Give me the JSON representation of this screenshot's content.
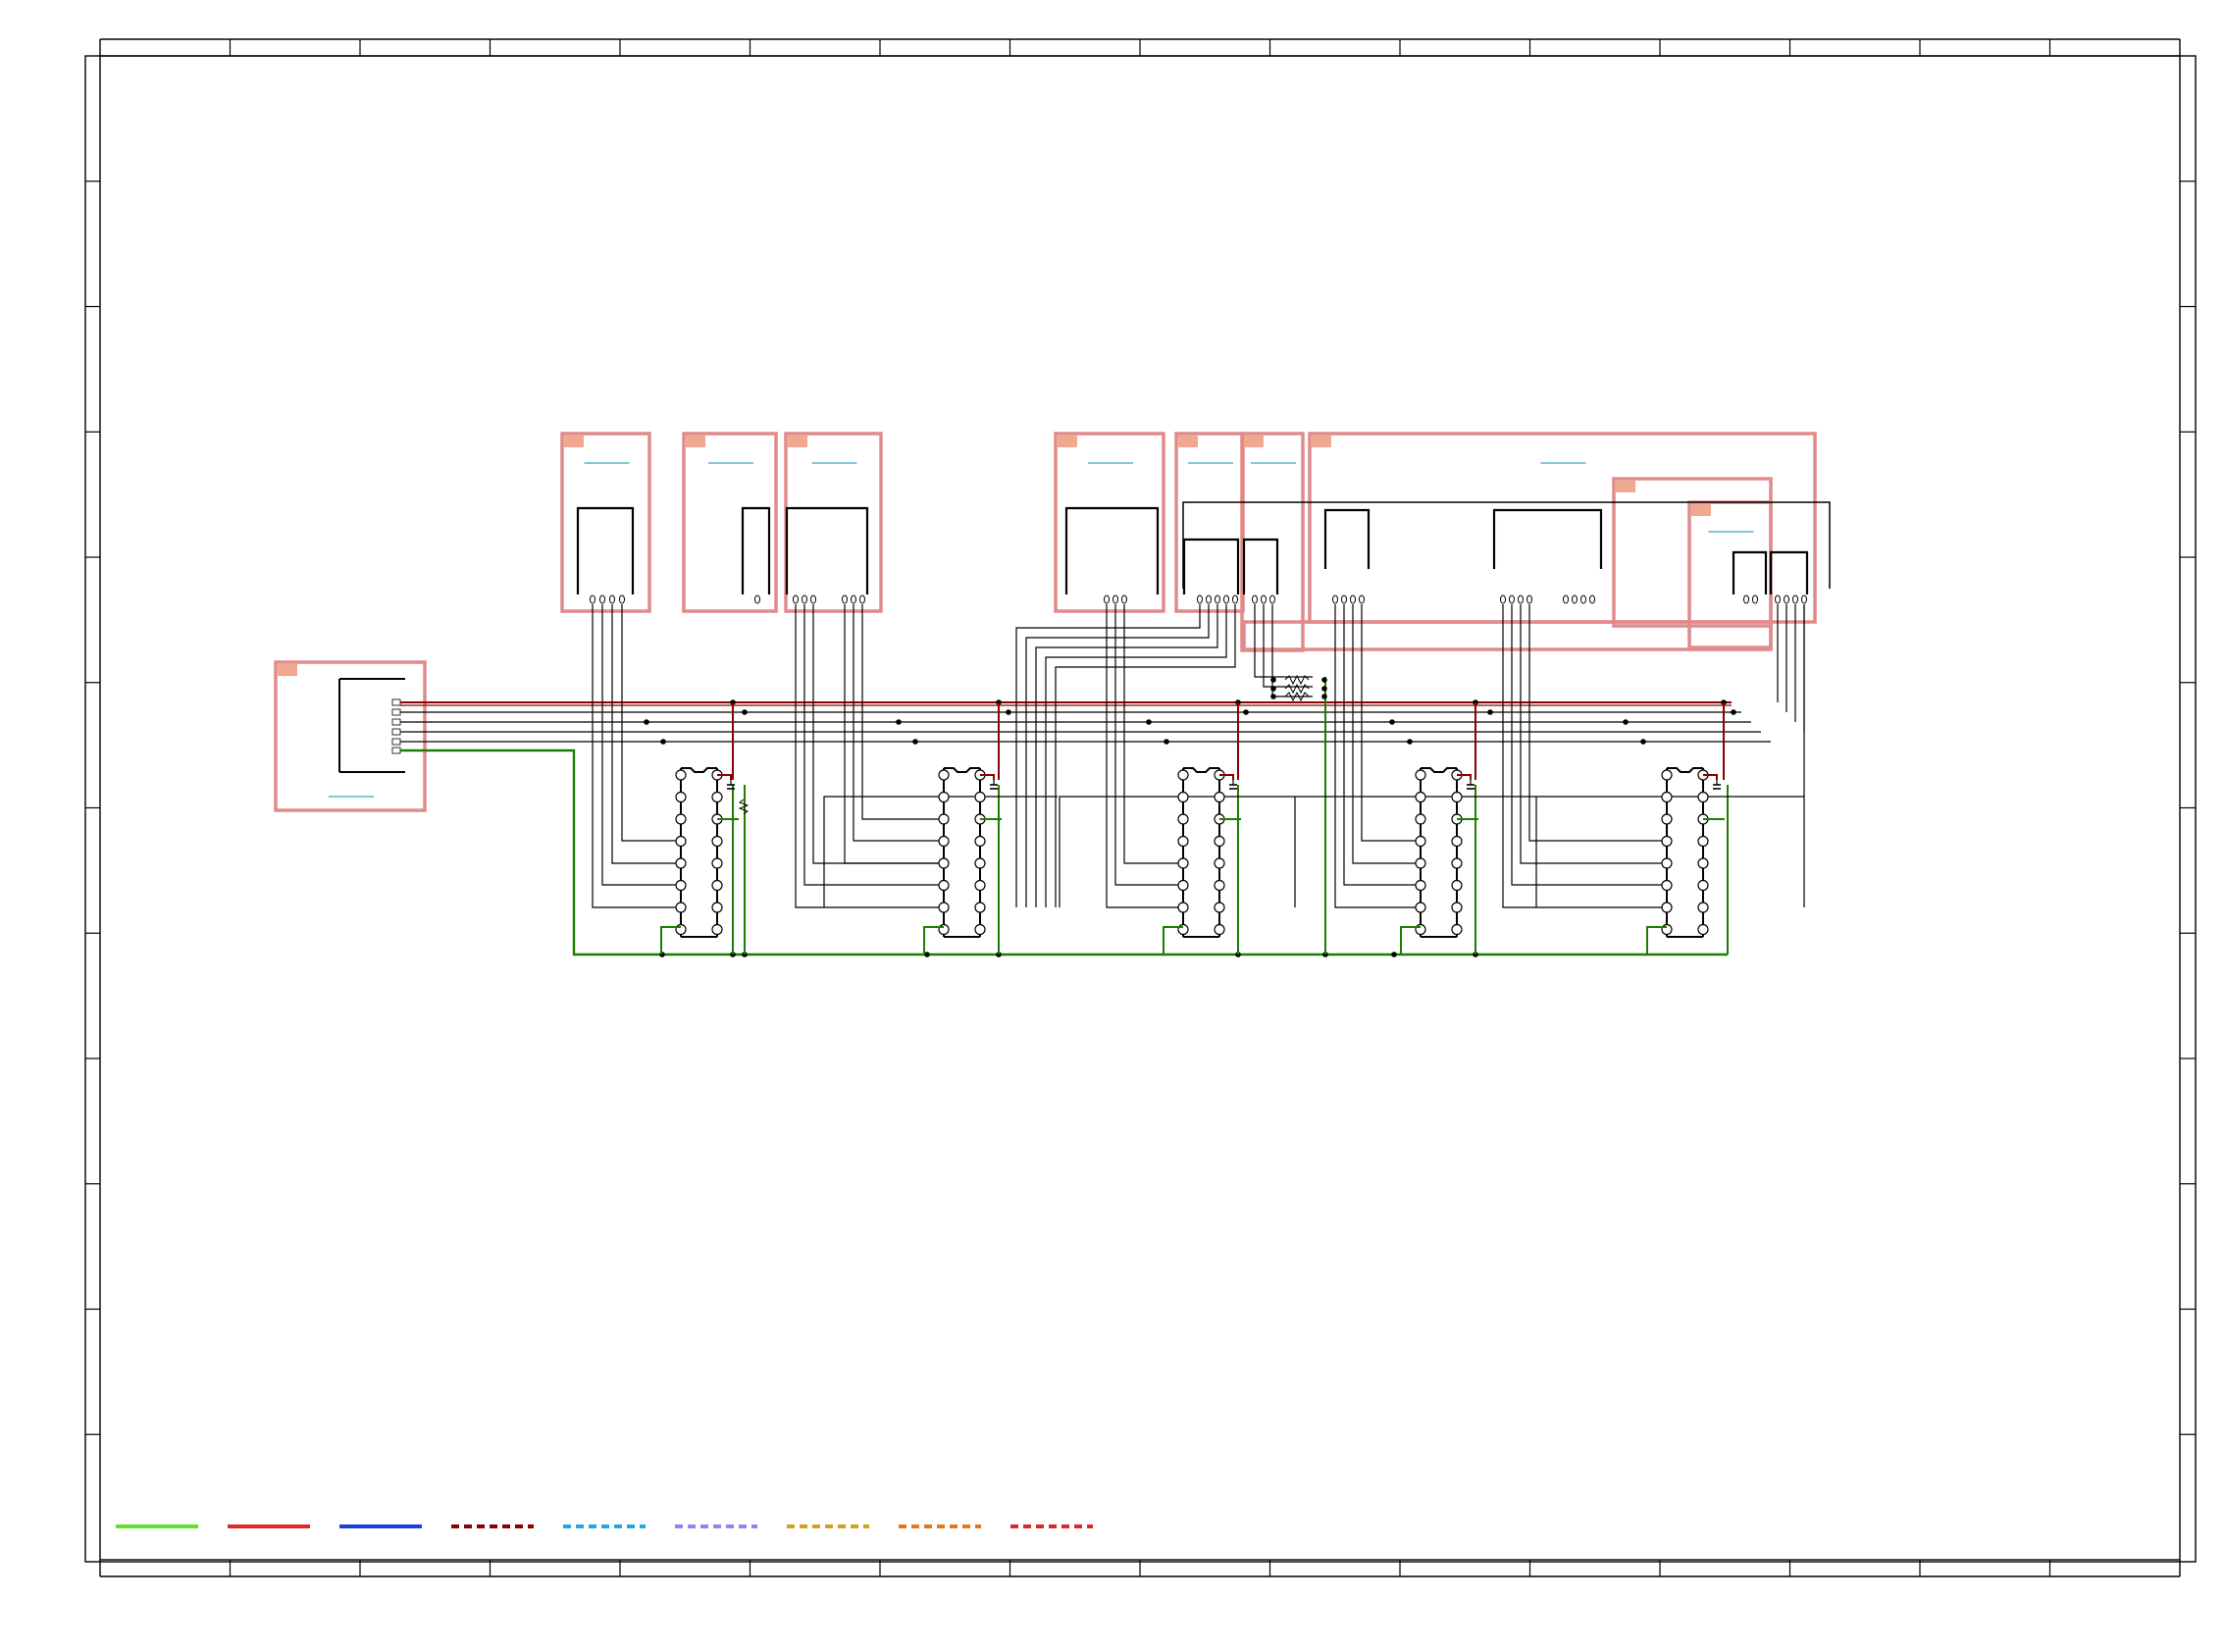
{
  "document": {
    "type": "schematic",
    "title": "",
    "sheet_label": ""
  },
  "colors": {
    "frame": "#000000",
    "wire": "#000000",
    "module_border": "#e08a8a",
    "module_flag": "#f0a890",
    "module_link": "#3aa5c8",
    "power_net": "#8b0000",
    "ground_net": "#1e7d00"
  },
  "legend": [
    {
      "id": "legend-green-solid",
      "color": "#5ee02a",
      "style": "solid",
      "label": ""
    },
    {
      "id": "legend-red-solid",
      "color": "#e02a2a",
      "style": "solid",
      "label": ""
    },
    {
      "id": "legend-blue-solid",
      "color": "#1f3fd9",
      "style": "solid",
      "label": ""
    },
    {
      "id": "legend-maroon-dash",
      "color": "#8b0000",
      "style": "dashed",
      "label": ""
    },
    {
      "id": "legend-cyan-dash",
      "color": "#22a8e0",
      "style": "dashed",
      "label": ""
    },
    {
      "id": "legend-violet-dash",
      "color": "#a07ef0",
      "style": "dashed",
      "label": ""
    },
    {
      "id": "legend-gold-dash",
      "color": "#d4a020",
      "style": "dashed",
      "label": ""
    },
    {
      "id": "legend-orange-dash",
      "color": "#e07a20",
      "style": "dashed",
      "label": ""
    },
    {
      "id": "legend-red-dash",
      "color": "#d92a2a",
      "style": "dashed",
      "label": ""
    }
  ],
  "modules": [
    {
      "id": "module-connector-main",
      "pins": 6
    },
    {
      "id": "module-1",
      "pins": 4
    },
    {
      "id": "module-2",
      "pins": 1
    },
    {
      "id": "module-3",
      "pins": 6
    },
    {
      "id": "module-4",
      "pins": 3
    },
    {
      "id": "module-5",
      "pins": 5
    },
    {
      "id": "module-6",
      "pins": 3
    },
    {
      "id": "module-7",
      "pins": 12
    },
    {
      "id": "module-8",
      "pins": 2
    },
    {
      "id": "module-9",
      "pins": 4
    }
  ],
  "chips": [
    {
      "id": "ic-1",
      "pins_per_side": 8
    },
    {
      "id": "ic-2",
      "pins_per_side": 8
    },
    {
      "id": "ic-3",
      "pins_per_side": 8
    },
    {
      "id": "ic-4",
      "pins_per_side": 8
    },
    {
      "id": "ic-5",
      "pins_per_side": 8
    }
  ]
}
